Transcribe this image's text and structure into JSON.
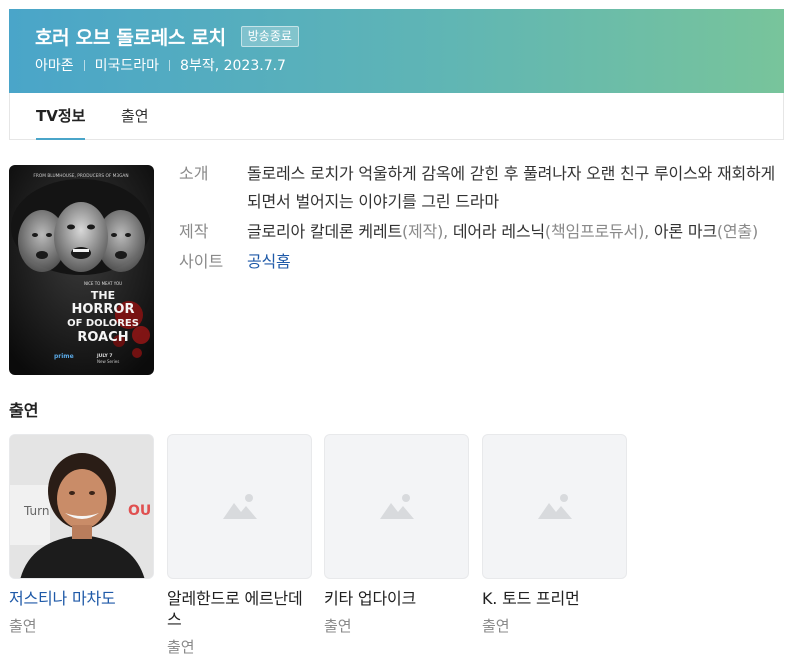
{
  "header": {
    "title": "호러 오브 돌로레스 로치",
    "badge": "방송종료",
    "meta": [
      "아마존",
      "미국드라마",
      "8부작, 2023.7.7"
    ],
    "gradient_start": "#4aa5c9",
    "gradient_end": "#78c49b"
  },
  "tabs": [
    {
      "label": "TV정보",
      "active": true
    },
    {
      "label": "출연",
      "active": false
    }
  ],
  "poster": {
    "top_text": "FROM BLUMHOUSE, PRODUCERS OF M3GAN",
    "tagline": "NICE TO MEAT YOU",
    "title_lines": [
      "THE",
      "HORROR",
      "OF DOLORES",
      "ROACH"
    ],
    "brand": "prime",
    "date": "JULY 7",
    "series": "New Series"
  },
  "info": {
    "intro_label": "소개",
    "intro_text": "돌로레스 로치가 억울하게 감옥에 갇힌 후 풀려나자 오랜 친구 루이스와 재회하게 되면서 벌어지는 이야기를 그린 드라마",
    "production_label": "제작",
    "production_parts": [
      {
        "name": "글로리아 칼데론 케레트",
        "role": "(제작)",
        "sep": ", "
      },
      {
        "name": "데어라 레스닉",
        "role": "(책임프로듀서)",
        "sep": ", "
      },
      {
        "name": "아론 마크",
        "role": "(연출)",
        "sep": ""
      }
    ],
    "site_label": "사이트",
    "site_link": "공식홈"
  },
  "cast": {
    "heading": "출연",
    "members": [
      {
        "name": "저스티나 마차도",
        "role": "출연",
        "has_photo": true,
        "photo_text": "Turn"
      },
      {
        "name": "알레한드로 에르난데스",
        "role": "출연",
        "has_photo": false
      },
      {
        "name": "키타 업다이크",
        "role": "출연",
        "has_photo": false
      },
      {
        "name": "K. 토드 프리먼",
        "role": "출연",
        "has_photo": false
      }
    ]
  }
}
